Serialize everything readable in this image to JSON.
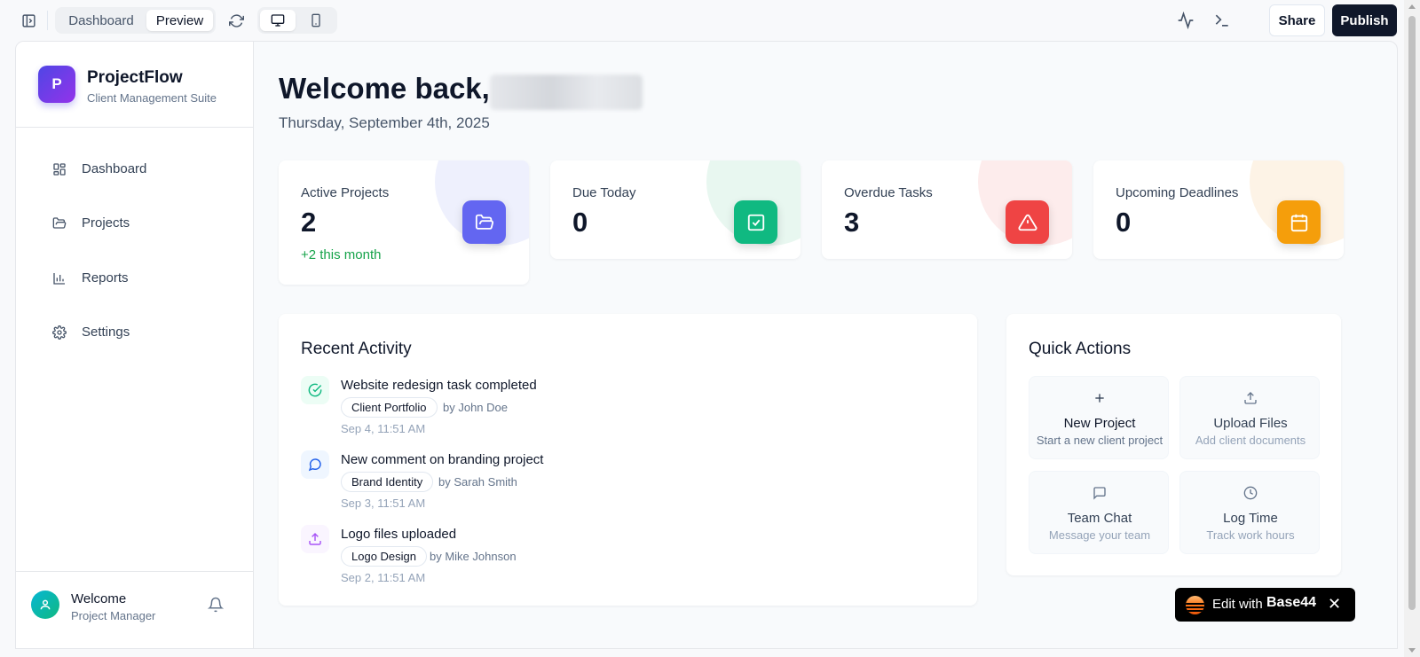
{
  "toolbar": {
    "tabs": [
      {
        "label": "Dashboard",
        "active": false
      },
      {
        "label": "Preview",
        "active": true
      }
    ],
    "view_modes": [
      "desktop-icon",
      "mobile-icon"
    ],
    "share_label": "Share",
    "publish_label": "Publish"
  },
  "sidebar": {
    "logo_letter": "P",
    "app_name": "ProjectFlow",
    "app_subtitle": "Client Management Suite",
    "items": [
      {
        "label": "Dashboard",
        "icon": "dashboard-icon"
      },
      {
        "label": "Projects",
        "icon": "folder-icon"
      },
      {
        "label": "Reports",
        "icon": "bar-chart-icon"
      },
      {
        "label": "Settings",
        "icon": "gear-icon"
      }
    ],
    "user": {
      "name": "Welcome",
      "role": "Project Manager"
    }
  },
  "main": {
    "welcome_text": "Welcome back,",
    "date": "Thursday, September 4th, 2025",
    "stats": [
      {
        "label": "Active Projects",
        "value": "2",
        "note": "+2 this month",
        "icon": "folder-open-icon",
        "color": "#6366f1",
        "tint": "#eef0fd"
      },
      {
        "label": "Due Today",
        "value": "0",
        "icon": "check-square-icon",
        "color": "#10b981",
        "tint": "#e8f7f0"
      },
      {
        "label": "Overdue Tasks",
        "value": "3",
        "icon": "alert-triangle-icon",
        "color": "#ef4444",
        "tint": "#fdecec"
      },
      {
        "label": "Upcoming Deadlines",
        "value": "0",
        "icon": "calendar-icon",
        "color": "#f59e0b",
        "tint": "#fdf3e6"
      }
    ],
    "recent_activity": {
      "title": "Recent Activity",
      "items": [
        {
          "title": "Website redesign task completed",
          "project": "Client Portfolio",
          "by": "by John Doe",
          "time": "Sep 4, 11:51 AM",
          "icon": "check-circle-icon"
        },
        {
          "title": "New comment on branding project",
          "project": "Brand Identity",
          "by": "by Sarah Smith",
          "time": "Sep 3, 11:51 AM",
          "icon": "message-icon"
        },
        {
          "title": "Logo files uploaded",
          "project": "Logo Design",
          "by": "by Mike Johnson",
          "time": "Sep 2, 11:51 AM",
          "icon": "upload-icon"
        }
      ]
    },
    "quick_actions": {
      "title": "Quick Actions",
      "items": [
        {
          "title": "New Project",
          "subtitle": "Start a new client project",
          "icon": "plus-icon"
        },
        {
          "title": "Upload Files",
          "subtitle": "Add client documents",
          "icon": "upload-icon"
        },
        {
          "title": "Team Chat",
          "subtitle": "Message your team",
          "icon": "chat-icon"
        },
        {
          "title": "Log Time",
          "subtitle": "Track work hours",
          "icon": "clock-icon"
        }
      ]
    }
  },
  "badge": {
    "text": "Edit with",
    "brand": "Base44",
    "close": "✕"
  }
}
